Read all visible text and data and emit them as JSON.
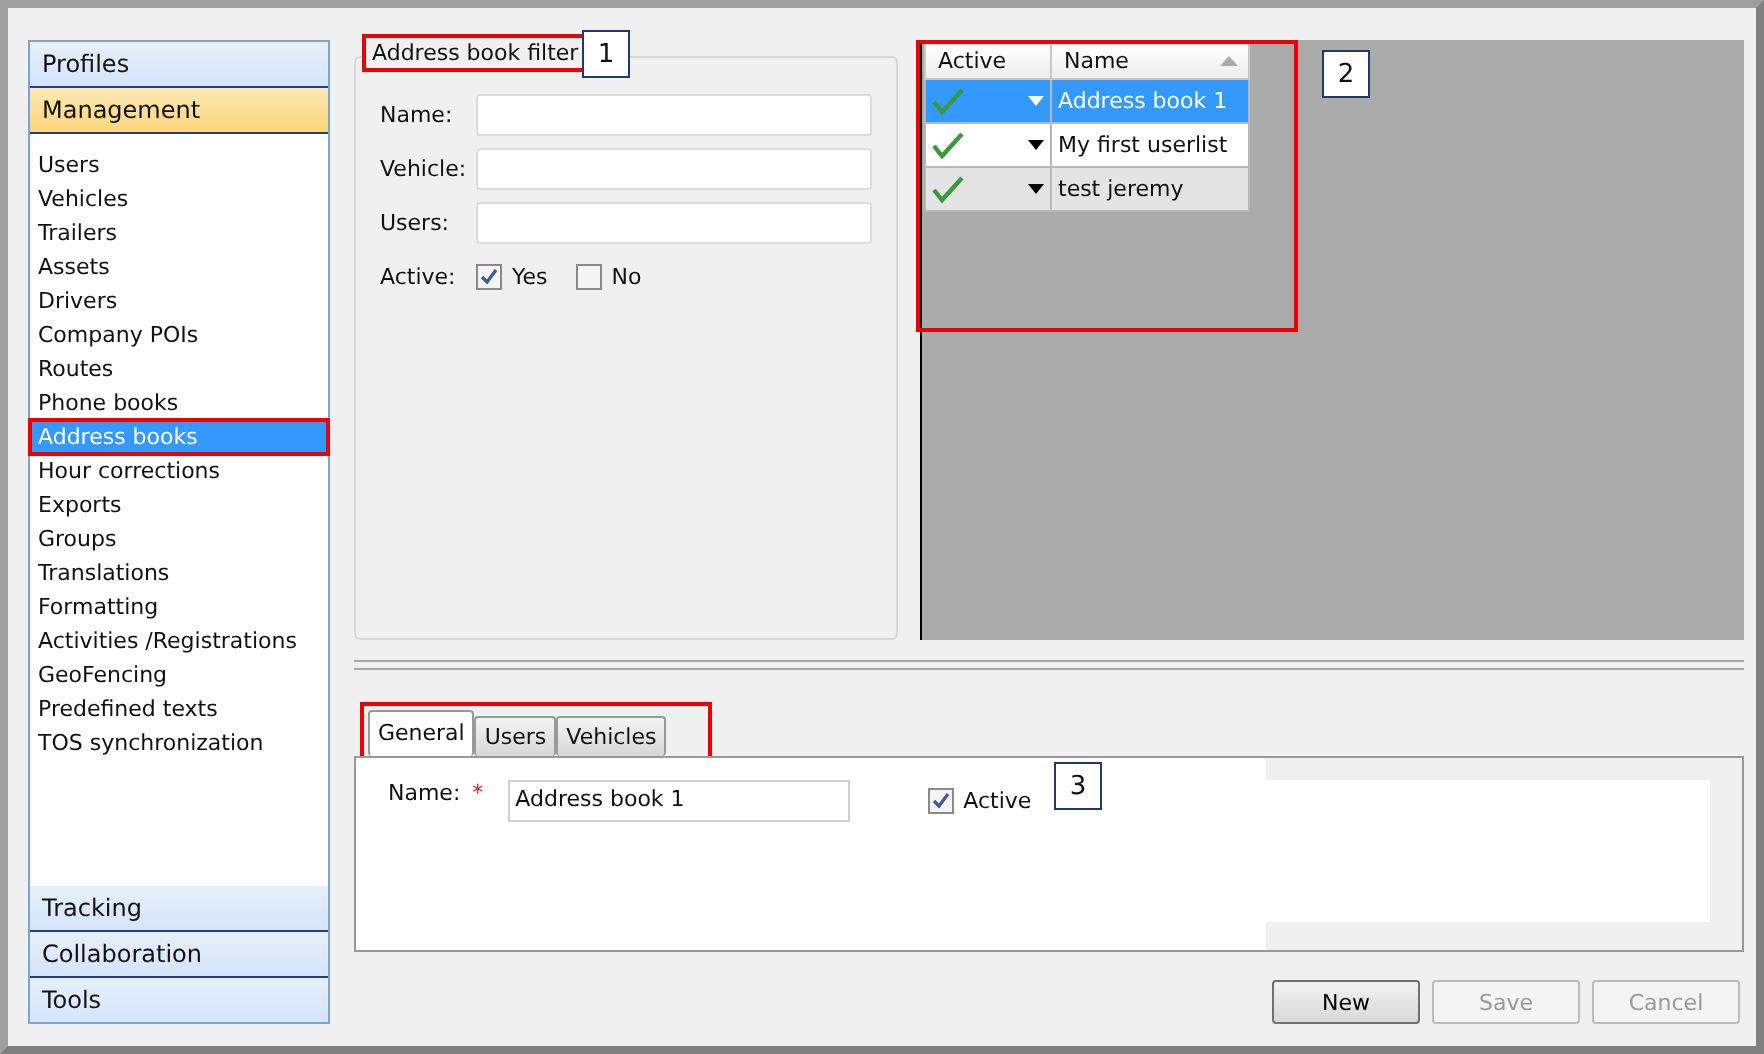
{
  "sidebar": {
    "top_sections": [
      {
        "label": "Profiles",
        "selected": false
      },
      {
        "label": "Management",
        "selected": true
      }
    ],
    "items": [
      {
        "label": "Users",
        "selected": false
      },
      {
        "label": "Vehicles",
        "selected": false
      },
      {
        "label": "Trailers",
        "selected": false
      },
      {
        "label": "Assets",
        "selected": false
      },
      {
        "label": "Drivers",
        "selected": false
      },
      {
        "label": "Company POIs",
        "selected": false
      },
      {
        "label": "Routes",
        "selected": false
      },
      {
        "label": "Phone books",
        "selected": false
      },
      {
        "label": "Address books",
        "selected": true
      },
      {
        "label": "Hour corrections",
        "selected": false
      },
      {
        "label": "Exports",
        "selected": false
      },
      {
        "label": "Groups",
        "selected": false
      },
      {
        "label": "Translations",
        "selected": false
      },
      {
        "label": "Formatting",
        "selected": false
      },
      {
        "label": "Activities /Registrations",
        "selected": false
      },
      {
        "label": "GeoFencing",
        "selected": false
      },
      {
        "label": "Predefined texts",
        "selected": false
      },
      {
        "label": "TOS synchronization",
        "selected": false
      }
    ],
    "bottom_sections": [
      {
        "label": "Tracking",
        "selected": false
      },
      {
        "label": "Collaboration",
        "selected": false
      },
      {
        "label": "Tools",
        "selected": false
      }
    ]
  },
  "filter": {
    "title": "Address book filter",
    "callout": "1",
    "fields": [
      {
        "label": "Name:"
      },
      {
        "label": "Vehicle:"
      },
      {
        "label": "Users:"
      }
    ],
    "active_label": "Active:",
    "options": [
      {
        "label": "Yes",
        "checked": true
      },
      {
        "label": "No",
        "checked": false
      }
    ]
  },
  "grid": {
    "callout": "2",
    "columns": [
      "Active",
      "Name"
    ],
    "rows": [
      {
        "active": true,
        "name": "Address book 1",
        "selected": true
      },
      {
        "active": true,
        "name": "My first userlist",
        "selected": false
      },
      {
        "active": true,
        "name": "test jeremy",
        "selected": false
      }
    ]
  },
  "tabs": [
    {
      "label": "General",
      "selected": true
    },
    {
      "label": "Users",
      "selected": false
    },
    {
      "label": "Vehicles",
      "selected": false
    }
  ],
  "details": {
    "callout": "3",
    "name_label": "Name:",
    "required_mark": "*",
    "name_value": "Address book 1",
    "active_label": "Active",
    "active_checked": true
  },
  "buttons": [
    {
      "label": "New",
      "disabled": false
    },
    {
      "label": "Save",
      "disabled": true
    },
    {
      "label": "Cancel",
      "disabled": true
    }
  ]
}
